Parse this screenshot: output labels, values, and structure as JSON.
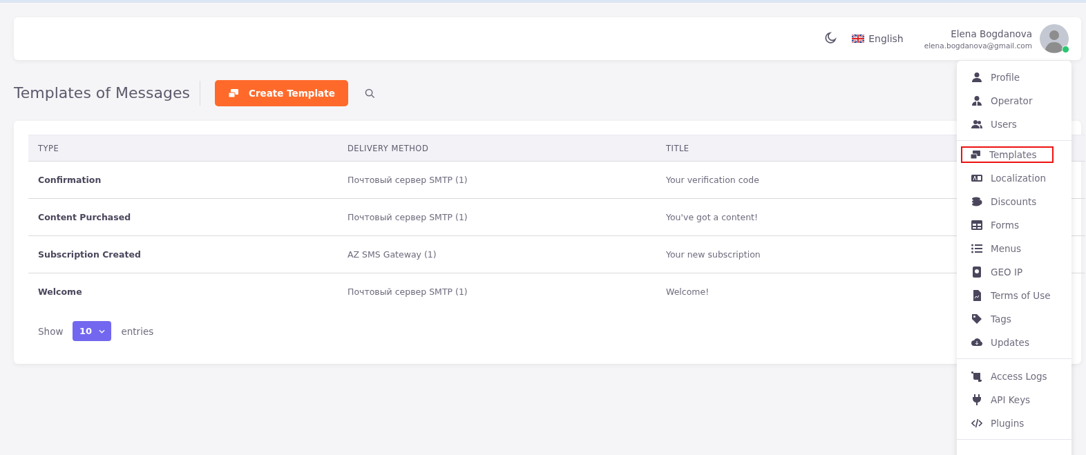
{
  "header": {
    "language": "English",
    "user": {
      "name": "Elena Bogdanova",
      "email": "elena.bogdanova@gmail.com",
      "online": true
    }
  },
  "page": {
    "title": "Templates of Messages",
    "create_button": "Create Template"
  },
  "table": {
    "columns": [
      "TYPE",
      "DELIVERY METHOD",
      "TITLE"
    ],
    "rows": [
      [
        "Confirmation",
        "Почтовый сервер SMTP (1)",
        "Your verification code"
      ],
      [
        "Content Purchased",
        "Почтовый сервер SMTP (1)",
        "You've got a content!"
      ],
      [
        "Subscription Created",
        "AZ SMS Gateway (1)",
        "Your new subscription"
      ],
      [
        "Welcome",
        "Почтовый сервер SMTP (1)",
        "Welcome!"
      ]
    ],
    "show_label": "Show",
    "page_size": "10",
    "entries_label": "entries"
  },
  "user_menu": {
    "groups": [
      {
        "items": [
          {
            "label": "Profile",
            "selected": false
          },
          {
            "label": "Operator",
            "selected": false
          },
          {
            "label": "Users",
            "selected": false
          }
        ]
      },
      {
        "items": [
          {
            "label": "Templates",
            "selected": true
          },
          {
            "label": "Localization",
            "selected": false
          },
          {
            "label": "Discounts",
            "selected": false
          },
          {
            "label": "Forms",
            "selected": false
          },
          {
            "label": "Menus",
            "selected": false
          },
          {
            "label": "GEO IP",
            "selected": false
          },
          {
            "label": "Terms of Use",
            "selected": false
          },
          {
            "label": "Tags",
            "selected": false
          },
          {
            "label": "Updates",
            "selected": false
          }
        ]
      },
      {
        "items": [
          {
            "label": "Access Logs",
            "selected": false
          },
          {
            "label": "API Keys",
            "selected": false
          },
          {
            "label": "Plugins",
            "selected": false
          }
        ]
      }
    ]
  }
}
